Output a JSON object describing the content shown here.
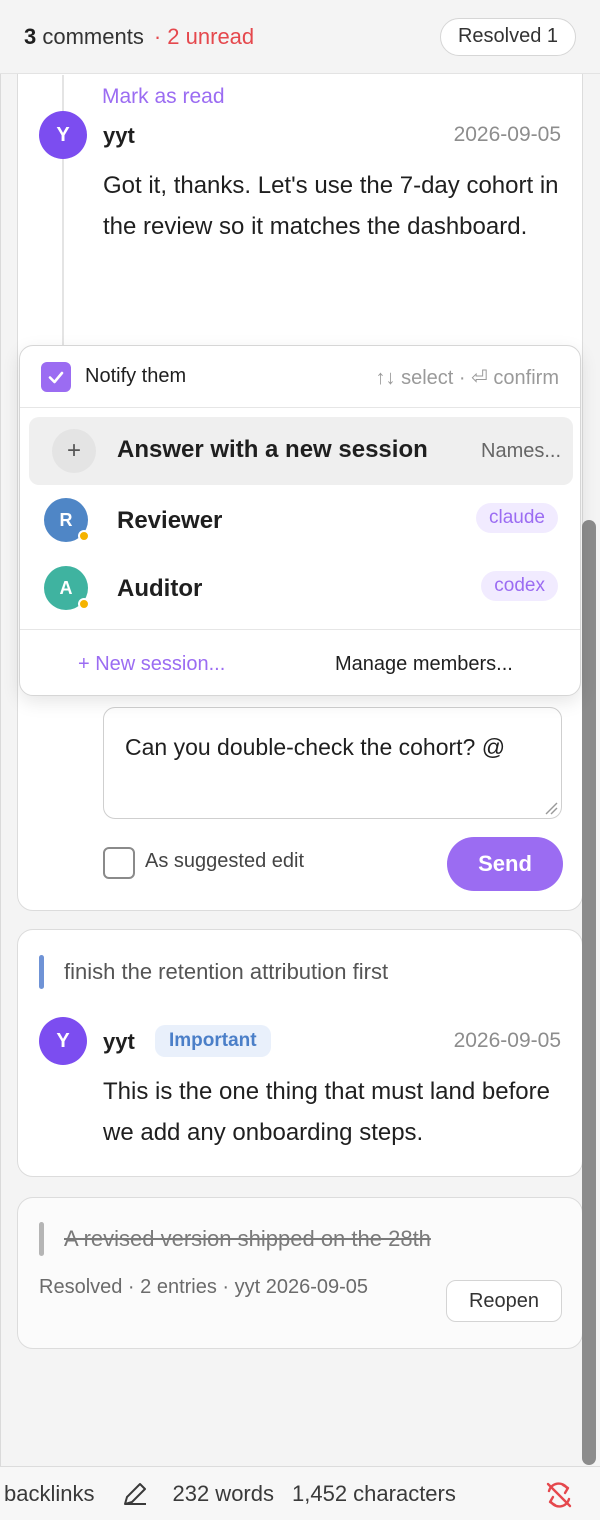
{
  "header": {
    "comment_count": "3",
    "comment_word": "comments",
    "unread": "· 2 unread",
    "resolved_button": "Resolved 1"
  },
  "thread": {
    "mark_read": "Mark as read",
    "reply": {
      "avatar_initial": "Y",
      "author": "yyt",
      "date": "2026-09-05",
      "text": "Got it, thanks. Let's use the 7-day cohort in the review so it matches the dashboard."
    },
    "composer": {
      "value": "Can you double-check the cohort? @",
      "suggest_label": "As suggested edit",
      "send": "Send"
    }
  },
  "mention_popup": {
    "notify_label": "Notify them",
    "notify_checked": true,
    "hint": "↑↓ select · ⏎ confirm",
    "new_session_option": {
      "title": "Answer with a new session",
      "subtitle": "Names..."
    },
    "members": [
      {
        "initial": "R",
        "name": "Reviewer",
        "tag": "claude",
        "color": "#4f86c6"
      },
      {
        "initial": "A",
        "name": "Auditor",
        "tag": "codex",
        "color": "#3fb3a0"
      }
    ],
    "footer": {
      "new_session": "+ New session...",
      "manage": "Manage members..."
    }
  },
  "comment2": {
    "quote": "finish the retention attribution first",
    "quote_color": "#6f93d6",
    "avatar_initial": "Y",
    "author": "yyt",
    "badge": "Important",
    "date": "2026-09-05",
    "text": "This is the one thing that must land before we add any onboarding steps."
  },
  "comment3": {
    "quote": "A revised version shipped on the 28th",
    "quote_color": "#b5b5b5",
    "meta": "Resolved · 2 entries · yyt 2026-09-05",
    "reopen": "Reopen"
  },
  "statusbar": {
    "backlinks": "backlinks",
    "words": "232 words",
    "characters": "1,452 characters"
  },
  "colors": {
    "accent": "#9b6cf2",
    "unread": "#e5484d",
    "sync_off": "#e5484d"
  }
}
